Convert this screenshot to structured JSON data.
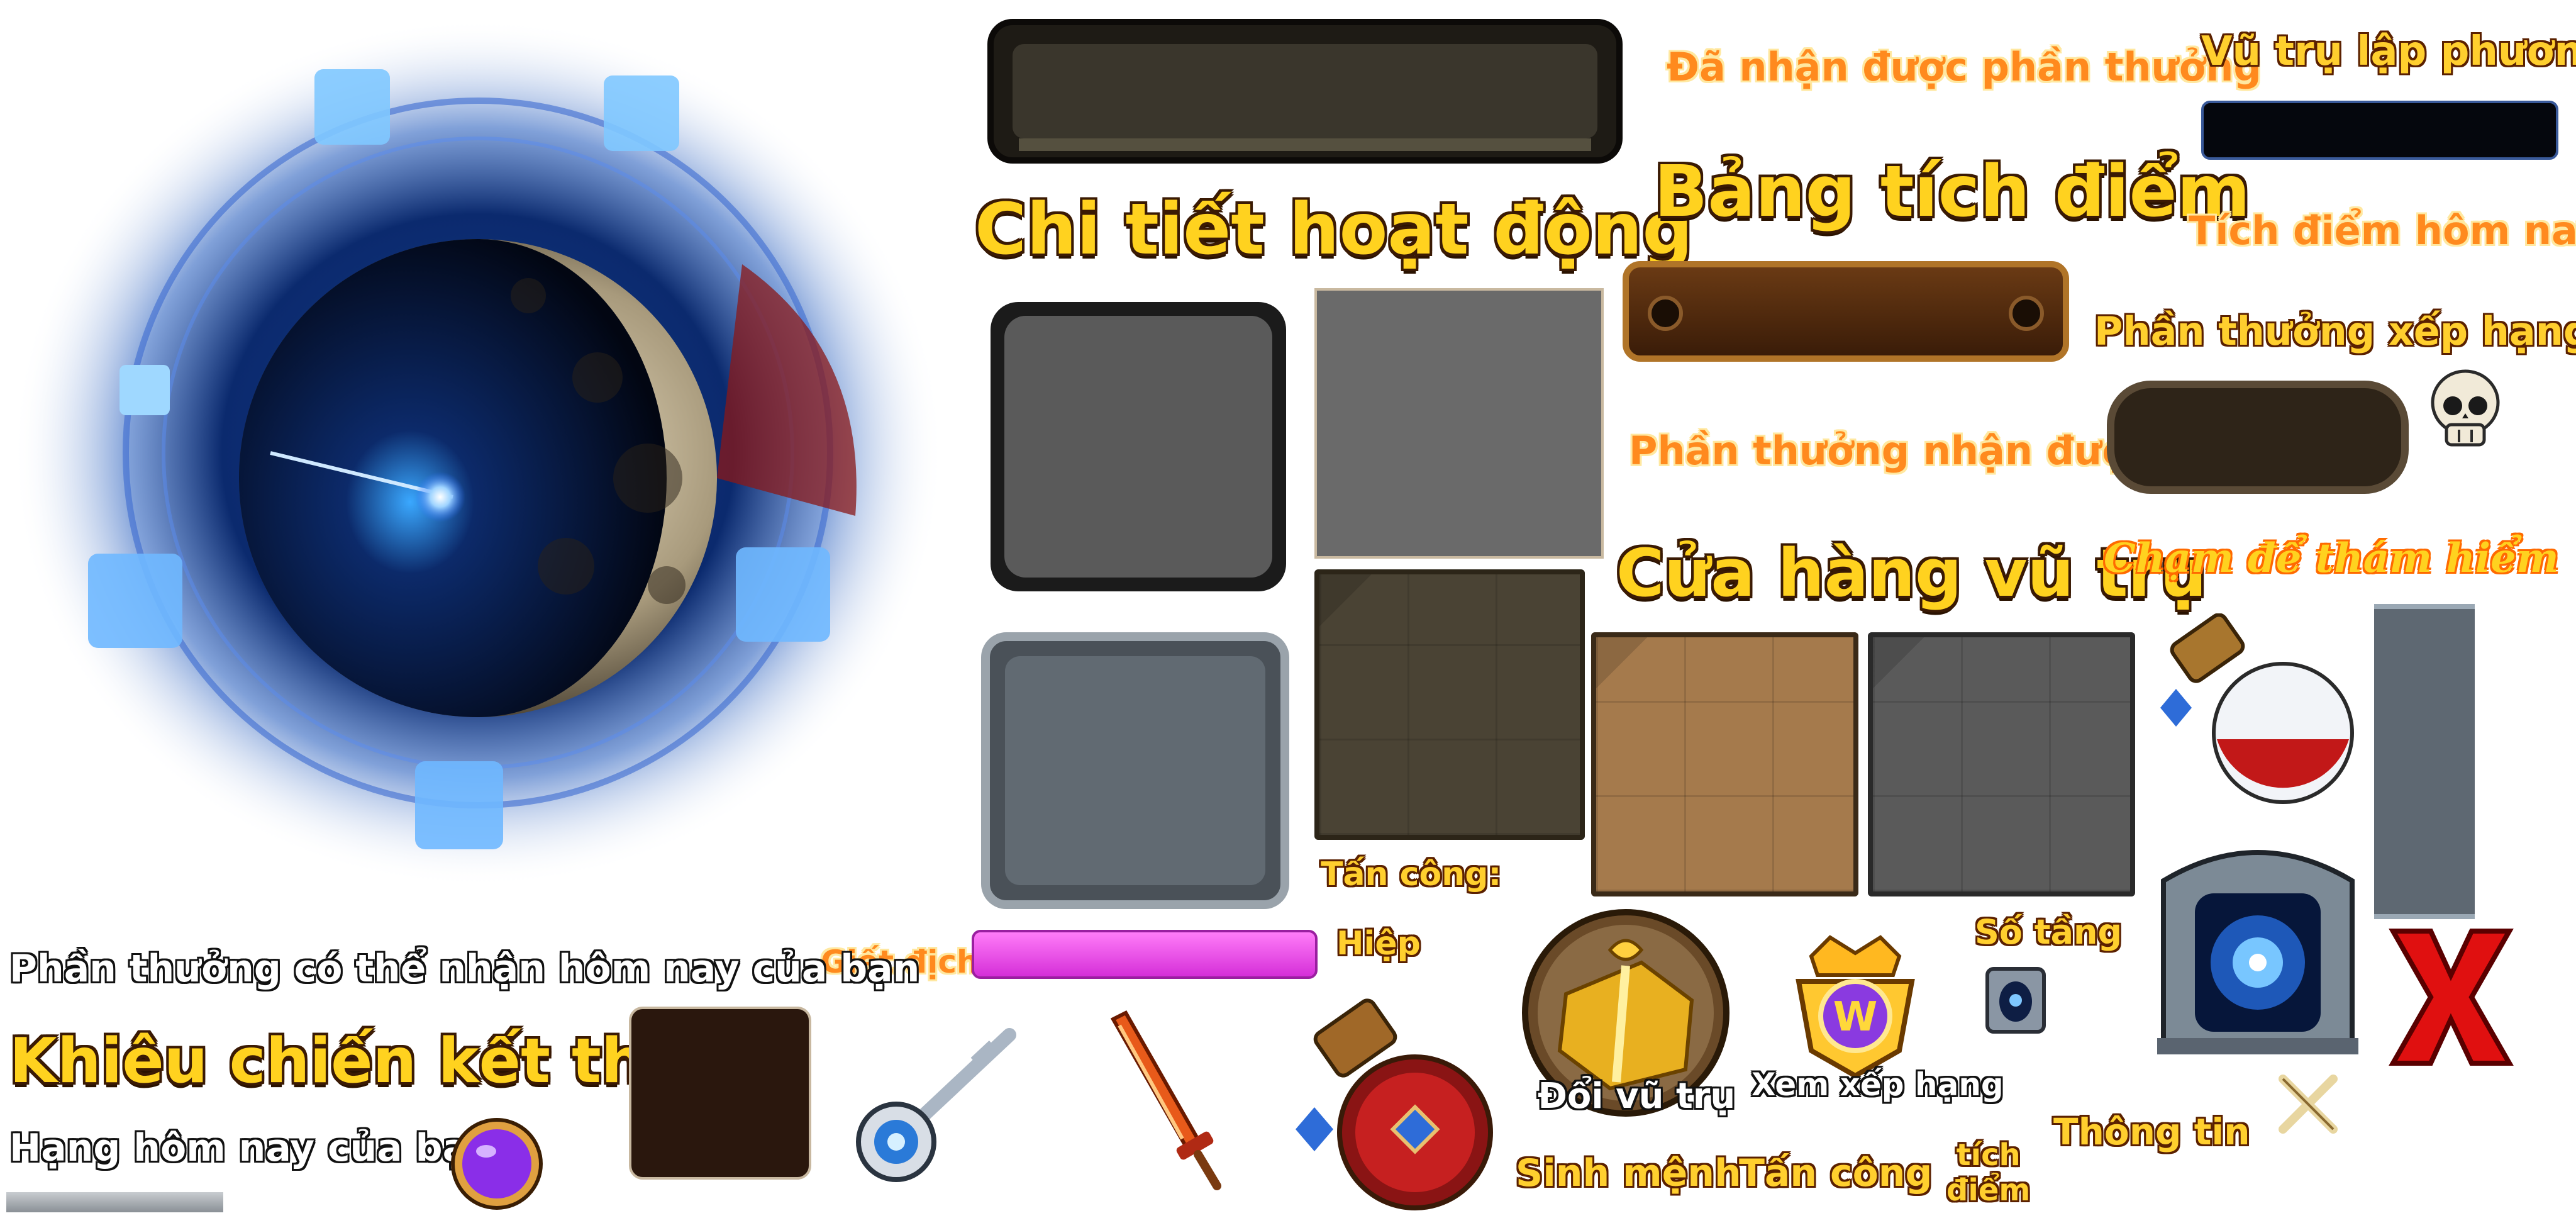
{
  "labels": {
    "da_nhan": "Đã nhận được phần thưởng",
    "vu_tru_lap_phuong": "Vũ trụ lập phương",
    "chi_tiet": "Chi tiết hoạt động",
    "bang_tich_diem": "Bảng tích điểm",
    "tich_diem_hom_nay": "Tích điểm hôm nay",
    "phan_thuong_xep_hang": "Phần thưởng xếp hạng",
    "phan_thuong_nhan_duoc": "Phần thưởng nhận được",
    "cua_hang": "Cửa hàng vũ trụ",
    "cham_de": "Chạm để thám hiểm",
    "tan_cong_colon": "Tấn công:",
    "hiep": "Hiệp",
    "giet_dich": "Giết địch",
    "so_tang": "Số tầng",
    "phan_thuong_co_the": "Phần thưởng có thể nhận hôm nay của bạn",
    "khieu_chien": "Khiêu chiến kết thúc",
    "hang_hom_nay": "Hạng hôm nay của bạn",
    "doi_vu_tru": "Đổi vũ trụ",
    "xem_xep_hang": "Xem xếp hạng",
    "thong_tin": "Thông tin",
    "sinh_menh": "Sinh mệnh",
    "tan_cong": "Tấn công",
    "tich_diem": "tích\nđiểm"
  },
  "icons": {
    "portal": "cosmic-portal-orb",
    "skull": "skull-icon",
    "potion_small": "red-potion-icon",
    "potion_big": "health-potion-icon",
    "gate": "stone-portal-gate-icon",
    "close": "close-x-icon",
    "swords": "crossed-swords-icon",
    "key": "key-icon",
    "sword": "flame-sword-icon",
    "gift": "gold-gift-icon",
    "rank": "rank-badge-icon",
    "rank_letter": "W",
    "orb": "purple-orb-icon",
    "mini_portal": "mini-portal-icon"
  },
  "colors": {
    "gold": "#ffd21f",
    "orange": "#ff8a1e",
    "magenta_bar": "#e33ce6",
    "close_red": "#e01010"
  }
}
